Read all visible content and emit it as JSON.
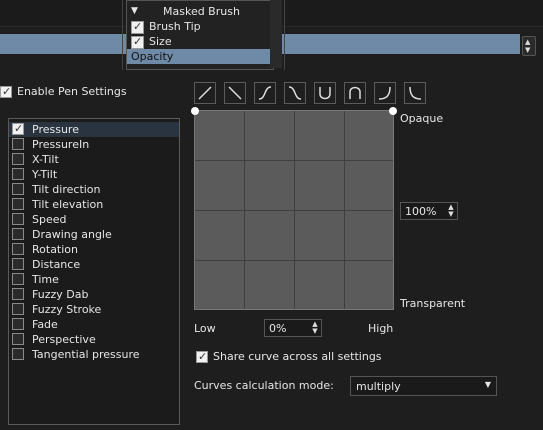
{
  "dropdown": {
    "title": "Masked Brush",
    "items": [
      {
        "label": "Brush Tip",
        "checked": true
      },
      {
        "label": "Size",
        "checked": true
      },
      {
        "label": "Opacity",
        "checked": false,
        "selected": true
      }
    ]
  },
  "enable_pen_settings": {
    "label": "Enable Pen Settings",
    "checked": true
  },
  "sensors": [
    {
      "label": "Pressure",
      "checked": true
    },
    {
      "label": "PressureIn",
      "checked": false
    },
    {
      "label": "X-Tilt",
      "checked": false
    },
    {
      "label": "Y-Tilt",
      "checked": false
    },
    {
      "label": "Tilt direction",
      "checked": false
    },
    {
      "label": "Tilt elevation",
      "checked": false
    },
    {
      "label": "Speed",
      "checked": false
    },
    {
      "label": "Drawing angle",
      "checked": false
    },
    {
      "label": "Rotation",
      "checked": false
    },
    {
      "label": "Distance",
      "checked": false
    },
    {
      "label": "Time",
      "checked": false
    },
    {
      "label": "Fuzzy Dab",
      "checked": false
    },
    {
      "label": "Fuzzy Stroke",
      "checked": false
    },
    {
      "label": "Fade",
      "checked": false
    },
    {
      "label": "Perspective",
      "checked": false
    },
    {
      "label": "Tangential pressure",
      "checked": false
    }
  ],
  "curve_presets": [
    "linear-icon",
    "reverse-linear-icon",
    "s-curve-icon",
    "reverse-s-curve-icon",
    "u-curve-icon",
    "arch-curve-icon",
    "j-curve-icon",
    "reverse-j-curve-icon"
  ],
  "curve_labels": {
    "top": "Opaque",
    "bottom": "Transparent",
    "low": "Low",
    "high": "High"
  },
  "max_value": "100%",
  "min_value": "0%",
  "share_curve": {
    "label": "Share curve across all settings",
    "checked": true
  },
  "curves_calc": {
    "label": "Curves calculation mode:",
    "value": "multiply"
  }
}
